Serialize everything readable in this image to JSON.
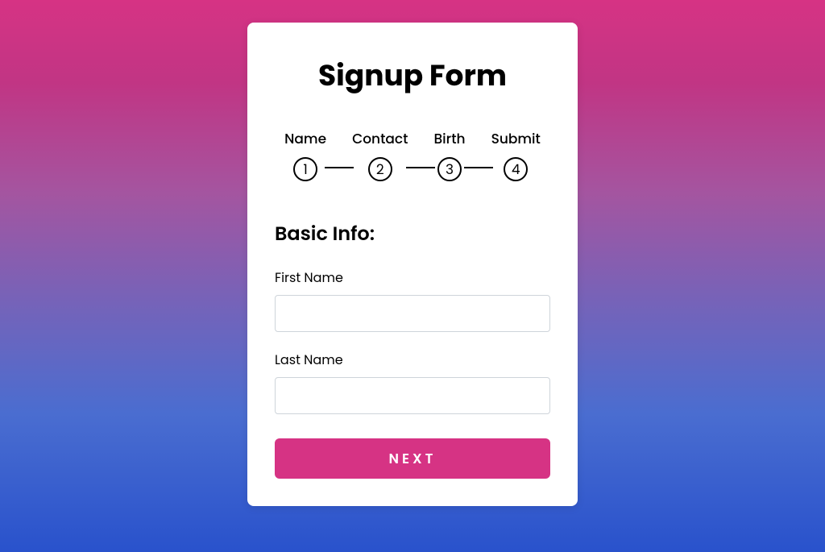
{
  "title": "Signup Form",
  "stepper": {
    "steps": [
      {
        "label": "Name",
        "number": "1"
      },
      {
        "label": "Contact",
        "number": "2"
      },
      {
        "label": "Birth",
        "number": "3"
      },
      {
        "label": "Submit",
        "number": "4"
      }
    ]
  },
  "section": {
    "title": "Basic Info:",
    "fields": [
      {
        "label": "First Name",
        "value": ""
      },
      {
        "label": "Last Name",
        "value": ""
      }
    ]
  },
  "buttons": {
    "next": "NEXT"
  },
  "colors": {
    "accent": "#d63384"
  }
}
